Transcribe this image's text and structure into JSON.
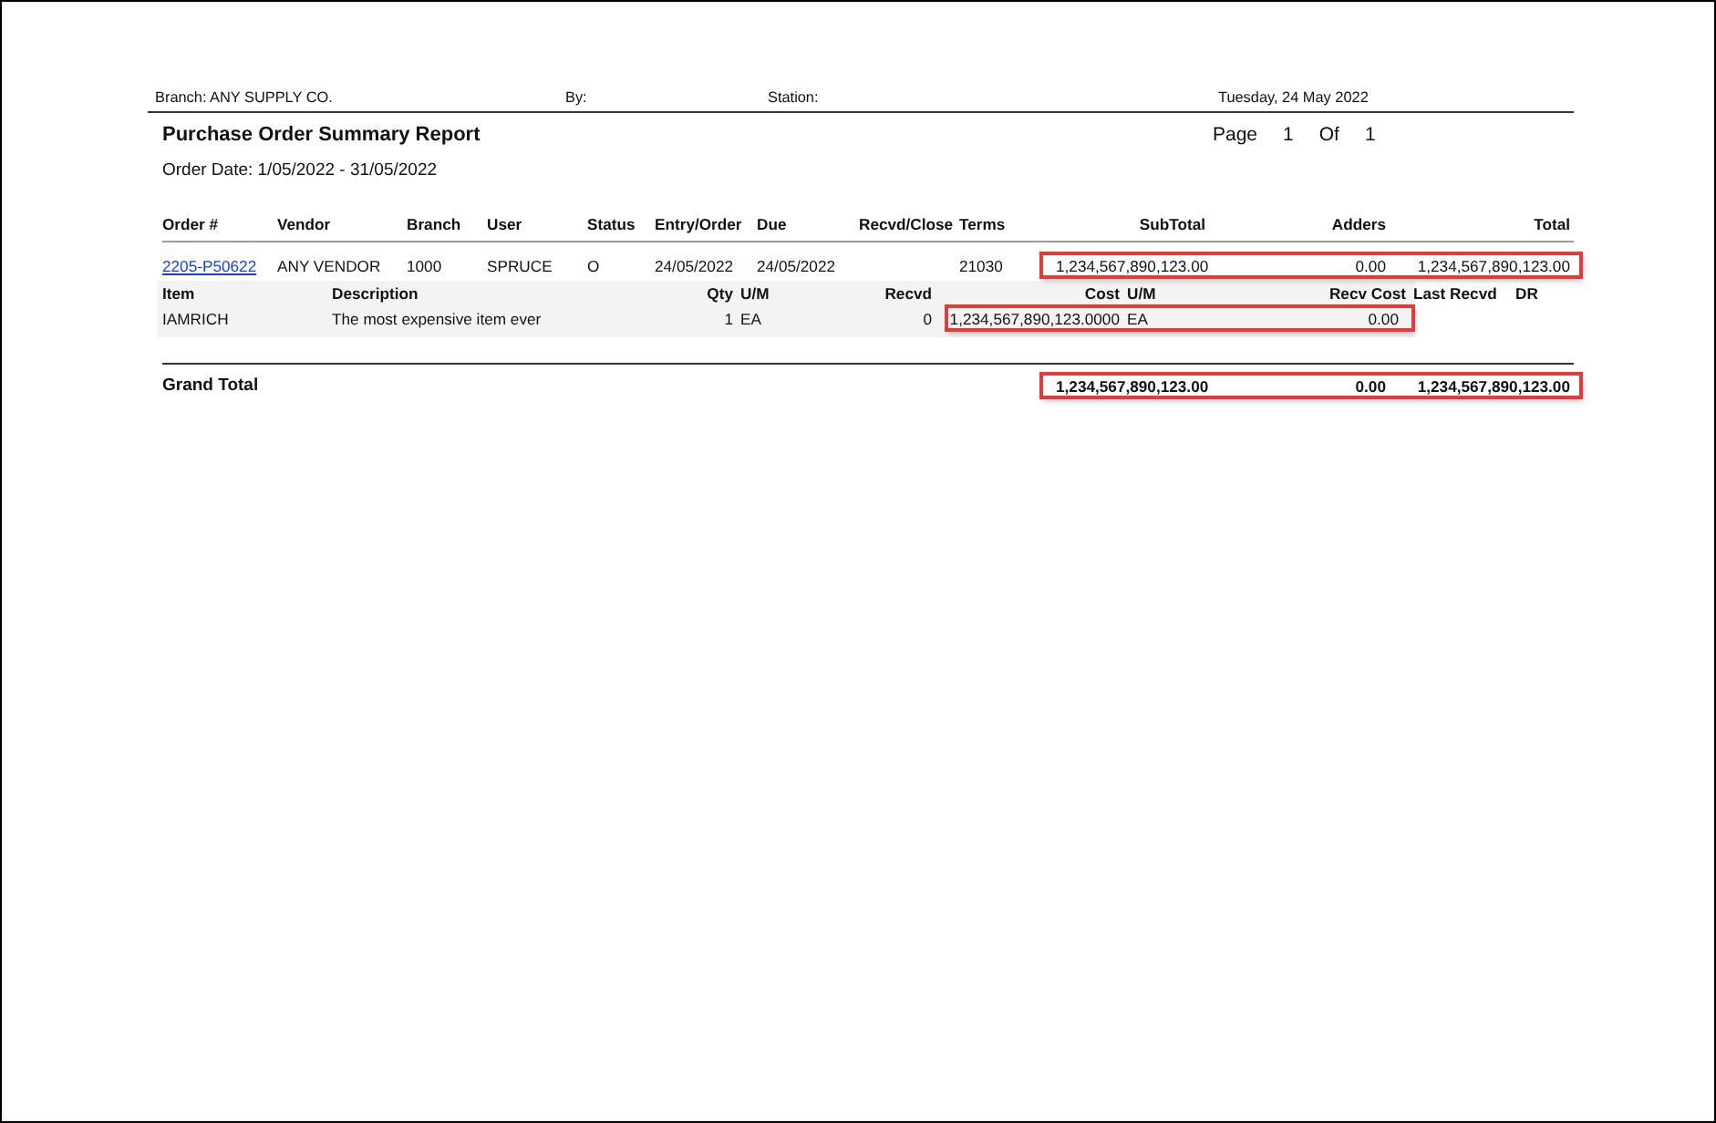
{
  "header": {
    "branch": "Branch: ANY SUPPLY CO.",
    "by": "By:",
    "station": "Station:",
    "date": "Tuesday, 24 May 2022"
  },
  "report": {
    "title": "Purchase Order Summary Report",
    "page_label": "Page",
    "page": "1",
    "of_label": "Of",
    "pages": "1",
    "order_date": "Order Date: 1/05/2022 - 31/05/2022"
  },
  "order_columns": [
    "Order #",
    "Vendor",
    "Branch",
    "User",
    "Status",
    "Entry/Order",
    "Due",
    "Recvd/Close",
    "Terms",
    "SubTotal",
    "Adders",
    "Total"
  ],
  "orders": [
    {
      "order_no": "2205-P50622",
      "vendor": "ANY VENDOR",
      "branch": "1000",
      "user": "SPRUCE",
      "status": "O",
      "entry_order": "24/05/2022",
      "due": "24/05/2022",
      "terms": "21030",
      "subtotal": "1,234,567,890,123.00",
      "adders": "0.00",
      "total": "1,234,567,890,123.00",
      "highlighted": true
    }
  ],
  "line_columns": [
    "Item",
    "Description",
    "Qty",
    "U/M",
    "Recvd",
    "Cost",
    "U/M",
    "Recv Cost",
    "Last Recvd",
    "DR"
  ],
  "lines": [
    {
      "item": "IAMRICH",
      "description": "The most expensive item ever",
      "qty": "1",
      "um": "EA",
      "recvd": "0",
      "cost": "1,234,567,890,123.0000",
      "cost_um": "EA",
      "recv_cost": "0.00",
      "highlighted": true
    }
  ],
  "grand_total": {
    "label": "Grand Total",
    "subtotal": "1,234,567,890,123.00",
    "adders": "0.00",
    "total": "1,234,567,890,123.00",
    "highlighted": true
  }
}
